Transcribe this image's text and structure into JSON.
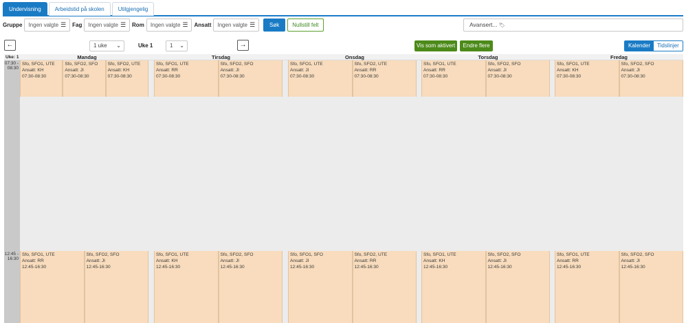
{
  "tabs": [
    {
      "label": "Undervisning",
      "active": true
    },
    {
      "label": "Arbeidstid på skolen",
      "active": false
    },
    {
      "label": "Utilgjengelig",
      "active": false
    }
  ],
  "filters": {
    "gruppe_label": "Gruppe",
    "gruppe_value": "Ingen valgte",
    "fag_label": "Fag",
    "fag_value": "Ingen valgte",
    "rom_label": "Rom",
    "rom_value": "Ingen valgte",
    "ansatt_label": "Ansatt",
    "ansatt_value": "Ingen valgte",
    "search_label": "Søk",
    "reset_label": "Nullstill felt",
    "advanced_label": "Avansert...",
    "burger_icon": "☰",
    "tag_icon": "🏷"
  },
  "nav": {
    "prev_icon": "←",
    "next_icon": "→",
    "period_value": "1 uke",
    "week_label": "Uke 1",
    "week_value": "1",
    "chevron": "⌄",
    "show_activated_label": "Vis som aktivert",
    "edit_many_label": "Endre flere",
    "view_calendar_label": "Kalender",
    "view_timelines_label": "Tidslinjer"
  },
  "calendar": {
    "week_label": "Uke: 1",
    "days": [
      "Mandag",
      "Tirsdag",
      "Onsdag",
      "Torsdag",
      "Fredag"
    ],
    "morning_time": "07:30 -\n08:30",
    "afternoon_time": "12:45 -\n16:30",
    "morning_events": [
      [
        {
          "title": "Sfo, SFO1, UTE",
          "staff": "Ansatt: KH",
          "time": "07:30-08:30"
        },
        {
          "title": "Sfo, SFO2, SFO",
          "staff": "Ansatt: JI",
          "time": "07:30-08:30"
        },
        {
          "title": "Sfo, SFO2, UTE",
          "staff": "Ansatt: KH",
          "time": "07:30-08:30"
        }
      ],
      [
        {
          "title": "Sfo, SFO1, UTE",
          "staff": "Ansatt: RR",
          "time": "07:30-08:30"
        },
        {
          "title": "Sfo, SFO2, SFO",
          "staff": "Ansatt: JI",
          "time": "07:30-08:30"
        }
      ],
      [
        {
          "title": "Sfo, SFO1, UTE",
          "staff": "Ansatt: JI",
          "time": "07:30-08:30"
        },
        {
          "title": "Sfo, SFO2, UTE",
          "staff": "Ansatt: RR",
          "time": "07:30-08:30"
        }
      ],
      [
        {
          "title": "Sfo, SFO1, UTE",
          "staff": "Ansatt: RR",
          "time": "07:30-08:30"
        },
        {
          "title": "Sfo, SFO2, SFO",
          "staff": "Ansatt: JI",
          "time": "07:30-08:30"
        }
      ],
      [
        {
          "title": "Sfo, SFO1, UTE",
          "staff": "Ansatt: KH",
          "time": "07:30-08:30"
        },
        {
          "title": "Sfo, SFO2, SFO",
          "staff": "Ansatt: JI",
          "time": "07:30-08:30"
        }
      ]
    ],
    "afternoon_events": [
      [
        {
          "title": "Sfo, SFO1, UTE",
          "staff": "Ansatt: RR",
          "time": "12:45-16:30"
        },
        {
          "title": "Sfo, SFO2, SFO",
          "staff": "Ansatt: JI",
          "time": "12:45-16:30"
        }
      ],
      [
        {
          "title": "Sfo, SFO1, UTE",
          "staff": "Ansatt: KH",
          "time": "12:45-16:30"
        },
        {
          "title": "Sfo, SFO2, SFO",
          "staff": "Ansatt: JI",
          "time": "12:45-16:30"
        }
      ],
      [
        {
          "title": "Sfo, SFO1, SFO",
          "staff": "Ansatt: JI",
          "time": "12:45-16:30"
        },
        {
          "title": "Sfo, SFO2, UTE",
          "staff": "Ansatt: RR",
          "time": "12:45-16:30"
        }
      ],
      [
        {
          "title": "Sfo, SFO1, UTE",
          "staff": "Ansatt: KH",
          "time": "12:45-16:30"
        },
        {
          "title": "Sfo, SFO2, SFO",
          "staff": "Ansatt: JI",
          "time": "12:45-16:30"
        }
      ],
      [
        {
          "title": "Sfo, SFO1, UTE",
          "staff": "Ansatt: RR",
          "time": "12:45-16:30"
        },
        {
          "title": "Sfo, SFO2, SFO",
          "staff": "Ansatt: JI",
          "time": "12:45-16:30"
        }
      ]
    ]
  }
}
